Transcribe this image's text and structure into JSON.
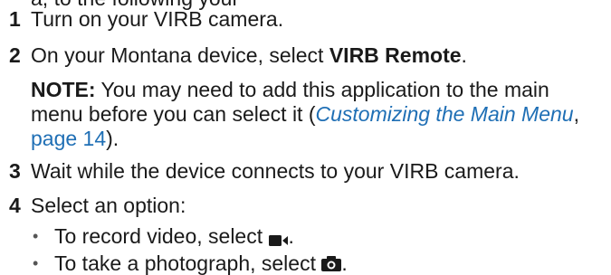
{
  "cut_off_line": "a, to the following your",
  "steps": [
    {
      "number": "1",
      "text": "Turn on your VIRB camera."
    },
    {
      "number": "2",
      "text_before": "On your Montana device, select ",
      "bold": "VIRB Remote",
      "text_after": "."
    },
    {
      "number": "3",
      "text": "Wait while the device connects to your VIRB camera."
    },
    {
      "number": "4",
      "text": "Select an option:"
    }
  ],
  "note": {
    "label": "NOTE:",
    "text": " You may need to add this application to the main menu before you can select it (",
    "link_title": "Customizing the Main Menu",
    "link_sep": ", ",
    "link_page": "page 14",
    "text_end": ")."
  },
  "bullets": [
    {
      "text": "To record video, select ",
      "icon": "video-camera-icon",
      "end": "."
    },
    {
      "text": "To take a photograph, select ",
      "icon": "camera-icon",
      "end": "."
    }
  ],
  "colors": {
    "link": "#1f6fb5",
    "text": "#1a1a1a"
  }
}
